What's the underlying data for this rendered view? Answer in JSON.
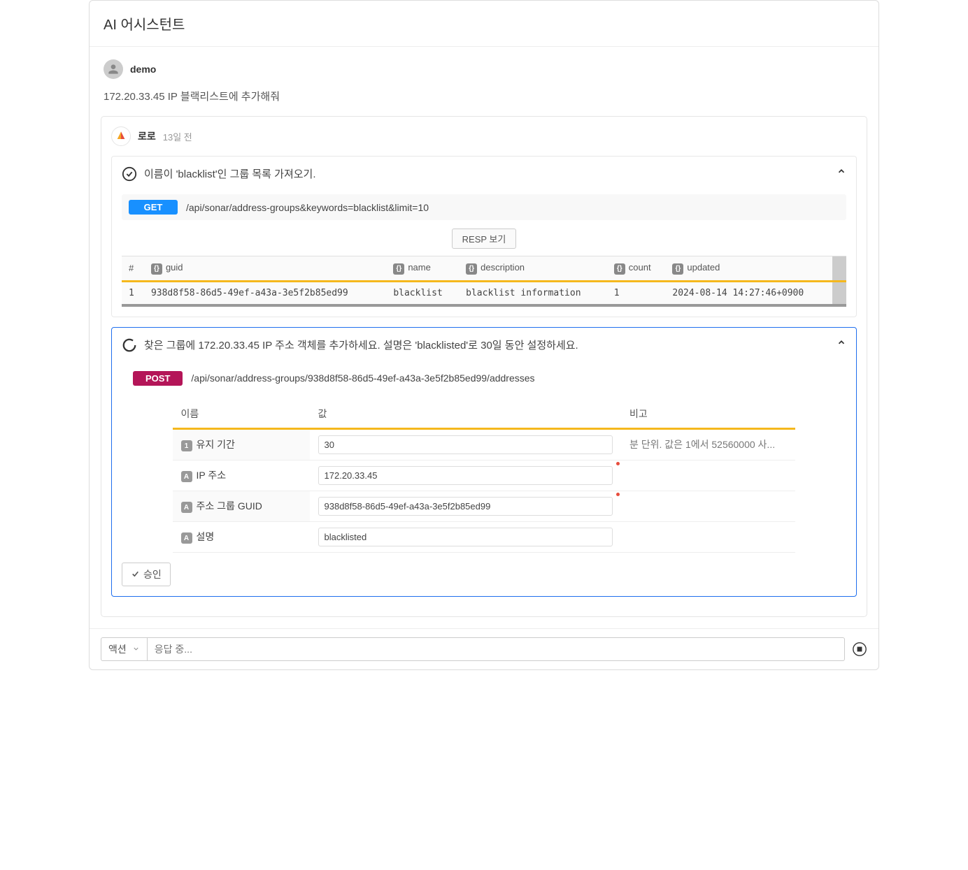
{
  "header": {
    "title": "AI 어시스턴트"
  },
  "user": {
    "name": "demo",
    "message": "172.20.33.45 IP 블랙리스트에 추가해줘"
  },
  "assistant": {
    "name": "로로",
    "timestamp": "13일 전"
  },
  "step1": {
    "title": "이름이 'blacklist'인 그룹 목록 가져오기.",
    "method": "GET",
    "path": "/api/sonar/address-groups&keywords=blacklist&limit=10",
    "resp_button": "RESP 보기",
    "columns": {
      "idx": "#",
      "guid": "guid",
      "name": "name",
      "description": "description",
      "count": "count",
      "updated": "updated"
    },
    "row": {
      "idx": "1",
      "guid": "938d8f58-86d5-49ef-a43a-3e5f2b85ed99",
      "name": "blacklist",
      "description": "blacklist information",
      "count": "1",
      "updated": "2024-08-14 14:27:46+0900"
    }
  },
  "step2": {
    "title": "찾은 그룹에 172.20.33.45 IP 주소 객체를 추가하세요. 설명은 'blacklisted'로 30일 동안 설정하세요.",
    "method": "POST",
    "path": "/api/sonar/address-groups/938d8f58-86d5-49ef-a43a-3e5f2b85ed99/addresses",
    "headers": {
      "name": "이름",
      "value": "값",
      "note": "비고"
    },
    "params": [
      {
        "type": "1",
        "name": "유지 기간",
        "value": "30",
        "note": "분 단위. 값은 1에서 52560000 사...",
        "required": false
      },
      {
        "type": "A",
        "name": "IP 주소",
        "value": "172.20.33.45",
        "note": "",
        "required": true
      },
      {
        "type": "A",
        "name": "주소 그룹 GUID",
        "value": "938d8f58-86d5-49ef-a43a-3e5f2b85ed99",
        "note": "",
        "required": true
      },
      {
        "type": "A",
        "name": "설명",
        "value": "blacklisted",
        "note": "",
        "required": false
      }
    ],
    "approve": "승인"
  },
  "footer": {
    "action_label": "액션",
    "input_placeholder": "응답 중..."
  }
}
